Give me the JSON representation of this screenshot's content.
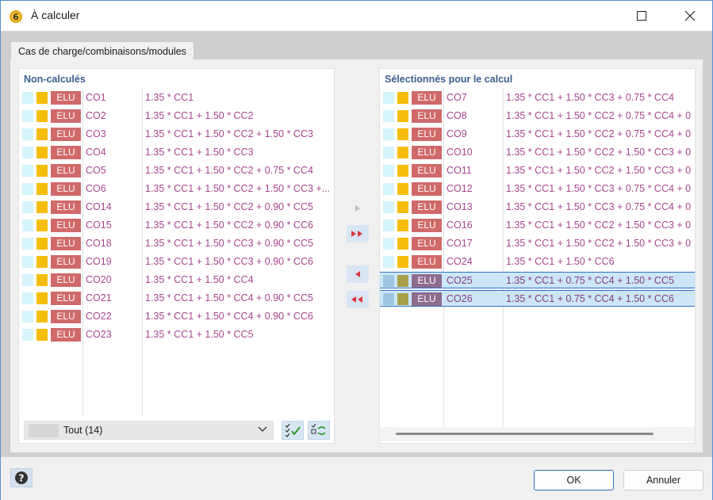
{
  "window": {
    "title": "À calculer",
    "colors": {
      "accent": "#2e6dc0",
      "elu_badge": "#d06969",
      "combo_text": "#a9458f",
      "selection": "#cde6f7"
    }
  },
  "tabs": [
    {
      "label": "Cas de charge/combinaisons/modules",
      "selected": true
    }
  ],
  "left_panel": {
    "title": "Non-calculés",
    "rows": [
      {
        "type": "ELU",
        "name": "CO1",
        "expr": "1.35 * CC1"
      },
      {
        "type": "ELU",
        "name": "CO2",
        "expr": "1.35 * CC1 + 1.50 * CC2"
      },
      {
        "type": "ELU",
        "name": "CO3",
        "expr": "1.35 * CC1 + 1.50 * CC2 + 1.50 * CC3"
      },
      {
        "type": "ELU",
        "name": "CO4",
        "expr": "1.35 * CC1 + 1.50 * CC3"
      },
      {
        "type": "ELU",
        "name": "CO5",
        "expr": "1.35 * CC1 + 1.50 * CC2 + 0.75 * CC4"
      },
      {
        "type": "ELU",
        "name": "CO6",
        "expr": "1.35 * CC1 + 1.50 * CC2 + 1.50 * CC3 +..."
      },
      {
        "type": "ELU",
        "name": "CO14",
        "expr": "1.35 * CC1 + 1.50 * CC2 + 0.90 * CC5"
      },
      {
        "type": "ELU",
        "name": "CO15",
        "expr": "1.35 * CC1 + 1.50 * CC2 + 0.90 * CC6"
      },
      {
        "type": "ELU",
        "name": "CO18",
        "expr": "1.35 * CC1 + 1.50 * CC3 + 0.90 * CC5"
      },
      {
        "type": "ELU",
        "name": "CO19",
        "expr": "1.35 * CC1 + 1.50 * CC3 + 0.90 * CC6"
      },
      {
        "type": "ELU",
        "name": "CO20",
        "expr": "1.35 * CC1 + 1.50 * CC4"
      },
      {
        "type": "ELU",
        "name": "CO21",
        "expr": "1.35 * CC1 + 1.50 * CC4 + 0.90 * CC5"
      },
      {
        "type": "ELU",
        "name": "CO22",
        "expr": "1.35 * CC1 + 1.50 * CC4 + 0.90 * CC6"
      },
      {
        "type": "ELU",
        "name": "CO23",
        "expr": "1.35 * CC1 + 1.50 * CC5"
      }
    ],
    "filter": {
      "value": "Tout (14)"
    }
  },
  "right_panel": {
    "title": "Sélectionnés pour le calcul",
    "rows": [
      {
        "type": "ELU",
        "name": "CO7",
        "expr": "1.35 * CC1 + 1.50 * CC3 + 0.75 * CC4",
        "selected": false
      },
      {
        "type": "ELU",
        "name": "CO8",
        "expr": "1.35 * CC1 + 1.50 * CC2 + 0.75 * CC4 + 0",
        "selected": false
      },
      {
        "type": "ELU",
        "name": "CO9",
        "expr": "1.35 * CC1 + 1.50 * CC2 + 0.75 * CC4 + 0",
        "selected": false
      },
      {
        "type": "ELU",
        "name": "CO10",
        "expr": "1.35 * CC1 + 1.50 * CC2 + 1.50 * CC3 + 0",
        "selected": false
      },
      {
        "type": "ELU",
        "name": "CO11",
        "expr": "1.35 * CC1 + 1.50 * CC2 + 1.50 * CC3 + 0",
        "selected": false
      },
      {
        "type": "ELU",
        "name": "CO12",
        "expr": "1.35 * CC1 + 1.50 * CC3 + 0.75 * CC4 + 0",
        "selected": false
      },
      {
        "type": "ELU",
        "name": "CO13",
        "expr": "1.35 * CC1 + 1.50 * CC3 + 0.75 * CC4 + 0",
        "selected": false
      },
      {
        "type": "ELU",
        "name": "CO16",
        "expr": "1.35 * CC1 + 1.50 * CC2 + 1.50 * CC3 + 0",
        "selected": false
      },
      {
        "type": "ELU",
        "name": "CO17",
        "expr": "1.35 * CC1 + 1.50 * CC2 + 1.50 * CC3 + 0",
        "selected": false
      },
      {
        "type": "ELU",
        "name": "CO24",
        "expr": "1.35 * CC1 + 1.50 * CC6",
        "selected": false
      },
      {
        "type": "ELU",
        "name": "CO25",
        "expr": "1.35 * CC1 + 0.75 * CC4 + 1.50 * CC5",
        "selected": true
      },
      {
        "type": "ELU",
        "name": "CO26",
        "expr": "1.35 * CC1 + 0.75 * CC4 + 1.50 * CC6",
        "selected": true
      }
    ]
  },
  "transfer_buttons": [
    {
      "icon": "arrow-right-icon",
      "enabled": false
    },
    {
      "icon": "double-arrow-right-icon",
      "enabled": true
    },
    {
      "icon": "arrow-left-icon",
      "enabled": true
    },
    {
      "icon": "double-arrow-left-icon",
      "enabled": true
    }
  ],
  "footer": {
    "ok_label": "OK",
    "cancel_label": "Annuler"
  }
}
